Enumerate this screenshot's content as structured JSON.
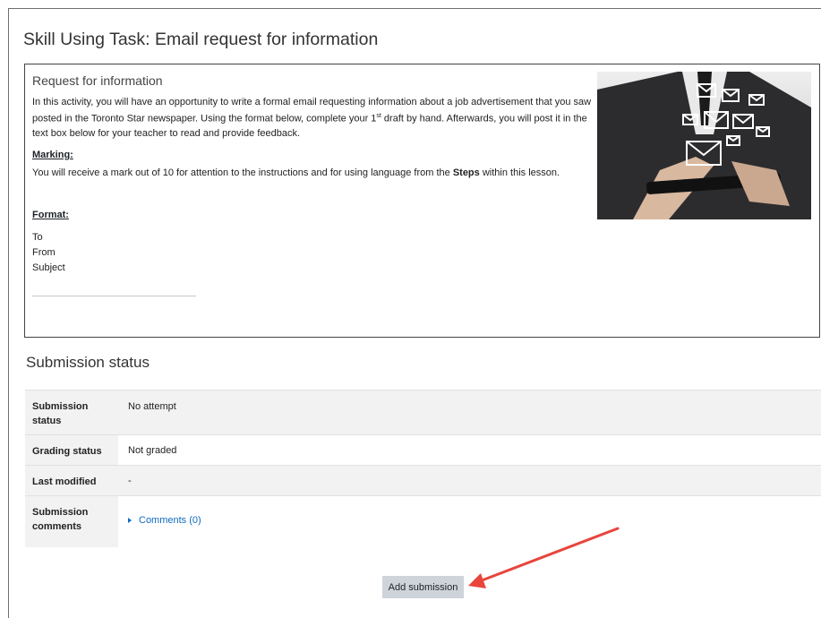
{
  "page_title": "Skill Using Task: Email request for information",
  "intro": {
    "title": "Request for information",
    "paragraph_pre": "In this activity, you will have an opportunity to write a formal email requesting information about a job advertisement that you saw posted in the Toronto Star newspaper. Using the format below, complete your 1",
    "paragraph_sup": "st",
    "paragraph_post": " draft by hand. Afterwards, you will post it in the text box below for your teacher to read and provide feedback.",
    "marking_label": "Marking:",
    "marking_pre": "You will receive a mark out of 10 for attention to the instructions and for using language from the ",
    "marking_bold": "Steps",
    "marking_post": " within this lesson.",
    "format_label": "Format:",
    "format_items": [
      "To",
      "From",
      "Subject"
    ]
  },
  "submission": {
    "title": "Submission status",
    "rows": [
      {
        "label": "Submission status",
        "value": "No attempt"
      },
      {
        "label": "Grading status",
        "value": "Not graded"
      },
      {
        "label": "Last modified",
        "value": "-"
      },
      {
        "label": "Submission comments",
        "value": "Comments (0)"
      }
    ]
  },
  "add_submission_label": "Add submission",
  "colors": {
    "link": "#0f6cbf",
    "arrow": "#e8453c",
    "button": "#ced4da"
  }
}
